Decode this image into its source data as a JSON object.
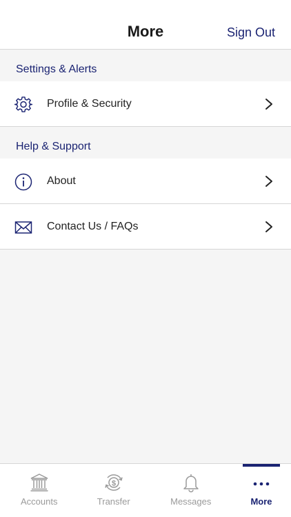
{
  "header": {
    "title": "More",
    "sign_out_label": "Sign Out"
  },
  "sections": [
    {
      "title": "Settings & Alerts",
      "items": [
        {
          "label": "Profile & Security",
          "icon": "gear-icon"
        }
      ]
    },
    {
      "title": "Help & Support",
      "items": [
        {
          "label": "About",
          "icon": "info-icon"
        },
        {
          "label": "Contact Us / FAQs",
          "icon": "envelope-icon"
        }
      ]
    }
  ],
  "tabs": [
    {
      "label": "Accounts",
      "icon": "bank-icon",
      "active": false
    },
    {
      "label": "Transfer",
      "icon": "transfer-dollar-icon",
      "active": false
    },
    {
      "label": "Messages",
      "icon": "bell-icon",
      "active": false
    },
    {
      "label": "More",
      "icon": "more-dots-icon",
      "active": true
    }
  ],
  "colors": {
    "accent": "#1a2372",
    "inactive": "#9a9a9a",
    "divider": "#d6d6d6",
    "background": "#f5f5f5"
  }
}
